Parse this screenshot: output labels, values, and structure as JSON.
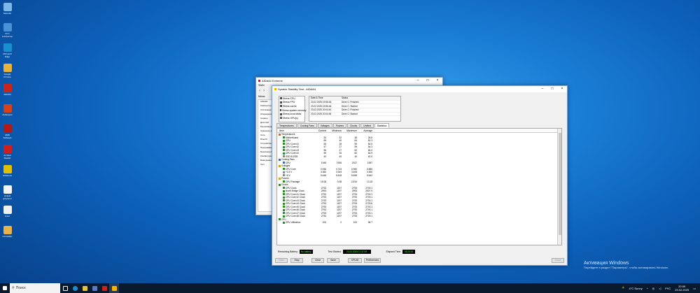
{
  "desktop_icons": [
    {
      "label": "Iskender",
      "icon": "recycle-bin-icon",
      "color": "#7ab8e8"
    },
    {
      "label": "Этот компьютер",
      "icon": "computer-icon",
      "color": "#4a90d9"
    },
    {
      "label": "Microsoft Edge",
      "icon": "edge-icon",
      "color": "#1a8fd0"
    },
    {
      "label": "Google Chrome",
      "icon": "chrome-icon",
      "color": "#e8b13a"
    },
    {
      "label": "AIDA64",
      "icon": "aida64-icon",
      "color": "#c8241c"
    },
    {
      "label": "Ashampoo",
      "icon": "ashampoo-icon",
      "color": "#d8401a"
    },
    {
      "label": "AMD Software",
      "icon": "amd-icon",
      "color": "#b21a1a"
    },
    {
      "label": "Acrobat Reader",
      "icon": "acrobat-icon",
      "color": "#cf1e1e"
    },
    {
      "label": "Avidemux",
      "icon": "avidemux-icon",
      "color": "#e0c000"
    },
    {
      "label": "Новый документ",
      "icon": "document-icon",
      "color": "#f4f4f4"
    },
    {
      "label": "Клип",
      "icon": "clapper-icon",
      "color": "#f0f0f0"
    },
    {
      "label": "Uninstaller",
      "icon": "globe-icon",
      "color": "#e8b24a"
    }
  ],
  "bg_window": {
    "title": "AIDA64 Extreme",
    "menu": "Файл",
    "tab": "Меню",
    "sidebar": [
      "AIDA64",
      "Компьютер",
      "Системная плата",
      "Операционная",
      "Сервер",
      "Дисплей",
      "Мультимедиа",
      "Хранение данных",
      "Сеть",
      "DirectX",
      "Устройства",
      "Программы",
      "Безопасность",
      "Конфигурация",
      "База данных",
      "Тест"
    ]
  },
  "main": {
    "title": "System Stability Test - AIDA64",
    "devices": [
      {
        "label": "Stress CPU",
        "checked": true
      },
      {
        "label": "Stress FPU",
        "checked": true
      },
      {
        "label": "Stress cache",
        "checked": true
      },
      {
        "label": "Stress system memory",
        "checked": true
      },
      {
        "label": "Stress local disks",
        "checked": true
      },
      {
        "label": "Stress GPU(s)",
        "checked": false
      }
    ],
    "log_headers": [
      "Date & Time",
      "Status"
    ],
    "log_rows": [
      [
        "23.02.2025 19:56:45",
        "Drive C: Finished"
      ],
      [
        "23.02.2025 19:56:46",
        "Drive C: Started"
      ],
      [
        "23.02.2025 20:04:40",
        "Drive C: Finished"
      ],
      [
        "23.02.2025 20:04:45",
        "Drive C: Started"
      ]
    ],
    "tabs": [
      "Temperatures",
      "Cooling Fans",
      "Voltages",
      "Powers",
      "Clocks",
      "Unified",
      "Statistics"
    ],
    "active_tab": "Statistics",
    "stats_headers": [
      "Item",
      "Current",
      "Minimum",
      "Maximum",
      "Average"
    ],
    "stats_rows": [
      {
        "kind": "group",
        "name": "Temperatures",
        "color": "#d46a1a"
      },
      {
        "kind": "item",
        "name": "Motherboard",
        "v": [
          "34",
          "32",
          "48",
          "34.8"
        ],
        "color": "#2a8a2a"
      },
      {
        "kind": "item",
        "name": "CPU",
        "v": [
          "65",
          "40",
          "64",
          "62.3"
        ],
        "color": "#2a8a2a"
      },
      {
        "kind": "item",
        "name": "CPU Core #1",
        "v": [
          "55",
          "28",
          "59",
          "54.5"
        ],
        "color": "#2a8a2a"
      },
      {
        "kind": "item",
        "name": "CPU Core #2",
        "v": [
          "57",
          "27",
          "59",
          "54.3"
        ],
        "color": "#2a8a2a"
      },
      {
        "kind": "item",
        "name": "CPU Core #3",
        "v": [
          "56",
          "27",
          "60",
          "56.0"
        ],
        "color": "#2a8a2a"
      },
      {
        "kind": "item",
        "name": "CPU Core #4",
        "v": [
          "55",
          "25",
          "60",
          "54.9"
        ],
        "color": "#2a8a2a"
      },
      {
        "kind": "item",
        "name": "SSD 512GB",
        "v": [
          "40",
          "40",
          "40",
          "40.0"
        ],
        "color": "#888888"
      },
      {
        "kind": "group",
        "name": "Cooling Fans",
        "color": "#2a6ad4"
      },
      {
        "kind": "item",
        "name": "CPU",
        "v": [
          "1945",
          "1906",
          "2027",
          "1957"
        ],
        "color": "#2a6ad4"
      },
      {
        "kind": "group",
        "name": "Voltages",
        "color": "#d4a41a"
      },
      {
        "kind": "item",
        "name": "CPU Core",
        "v": [
          "0.936",
          "0.743",
          "0.960",
          "0.880"
        ],
        "color": "#2a8a2a"
      },
      {
        "kind": "item",
        "name": "+3.3 V",
        "v": [
          "3.360",
          "3.344",
          "3.408",
          "3.360"
        ],
        "color": "#888888"
      },
      {
        "kind": "item",
        "name": "+5 V",
        "v": [
          "5.645",
          "5.618",
          "5.698",
          "5.642"
        ],
        "color": "#888888"
      },
      {
        "kind": "group",
        "name": "Powers",
        "color": "#d4a41a"
      },
      {
        "kind": "item",
        "name": "CPU Package",
        "v": [
          "15.08",
          "0.38",
          "15.54",
          "13.18"
        ],
        "color": "#2a8a2a"
      },
      {
        "kind": "group",
        "name": "Clocks",
        "color": "#2a8a2a"
      },
      {
        "kind": "item",
        "name": "CPU Clock",
        "v": [
          "2793",
          "1197",
          "2793",
          "2700.1"
        ],
        "color": "#2a8a2a"
      },
      {
        "kind": "item",
        "name": "North Bridge Clock",
        "v": [
          "2993",
          "1197",
          "2993",
          "2907.9"
        ],
        "color": "#2a8a2a"
      },
      {
        "kind": "item",
        "name": "CPU Core #1 Clock",
        "v": [
          "2793",
          "1197",
          "2793",
          "2700.1"
        ],
        "color": "#2a8a2a"
      },
      {
        "kind": "item",
        "name": "CPU Core #2 Clock",
        "v": [
          "2793",
          "1197",
          "2793",
          "2700.1"
        ],
        "color": "#2a8a2a"
      },
      {
        "kind": "item",
        "name": "CPU Core #3 Clock",
        "v": [
          "2793",
          "1197",
          "2793",
          "2700.1"
        ],
        "color": "#2a8a2a"
      },
      {
        "kind": "item",
        "name": "CPU Core #4 Clock",
        "v": [
          "2793",
          "1197",
          "2793",
          "2700.6"
        ],
        "color": "#2a8a2a"
      },
      {
        "kind": "item",
        "name": "CPU Core #5 Clock",
        "v": [
          "2793",
          "1197",
          "2793",
          "2700.1"
        ],
        "color": "#2a8a2a"
      },
      {
        "kind": "item",
        "name": "CPU Core #6 Clock",
        "v": [
          "2793",
          "1197",
          "2793",
          "2700.1"
        ],
        "color": "#2a8a2a"
      },
      {
        "kind": "item",
        "name": "CPU Core #7 Clock",
        "v": [
          "2793",
          "1197",
          "2793",
          "2700.1"
        ],
        "color": "#2a8a2a"
      },
      {
        "kind": "item",
        "name": "CPU Core #8 Clock",
        "v": [
          "2793",
          "1197",
          "2793",
          "2700.1"
        ],
        "color": "#2a8a2a"
      },
      {
        "kind": "group",
        "name": "CPU",
        "color": "#2a8a2a"
      },
      {
        "kind": "item",
        "name": "CPU Utilization",
        "v": [
          "100",
          "0",
          "100",
          "96.7"
        ],
        "color": "#2a8a2a"
      }
    ],
    "status": {
      "battery_label": "Remaining Battery:",
      "battery": "No battery",
      "started_label": "Test Started:",
      "started": "23.02.2025 17:47:09",
      "elapsed_label": "Elapsed Time:",
      "elapsed": "03:20:15"
    },
    "buttons": {
      "start": "Start",
      "stop": "Stop",
      "clear": "Clear",
      "save": "Save",
      "cpuid": "CPUID",
      "preferences": "Preferences",
      "close": "Close"
    }
  },
  "watermark": {
    "title": "Активация Windows",
    "subtitle": "Перейдите в раздел \"Параметры\", чтобы активировать Windows."
  },
  "taskbar": {
    "search_placeholder": "Поиск",
    "weather": "4°C Sunny",
    "time": "20:09",
    "date": "23.02.2025",
    "lang": "РУС"
  }
}
